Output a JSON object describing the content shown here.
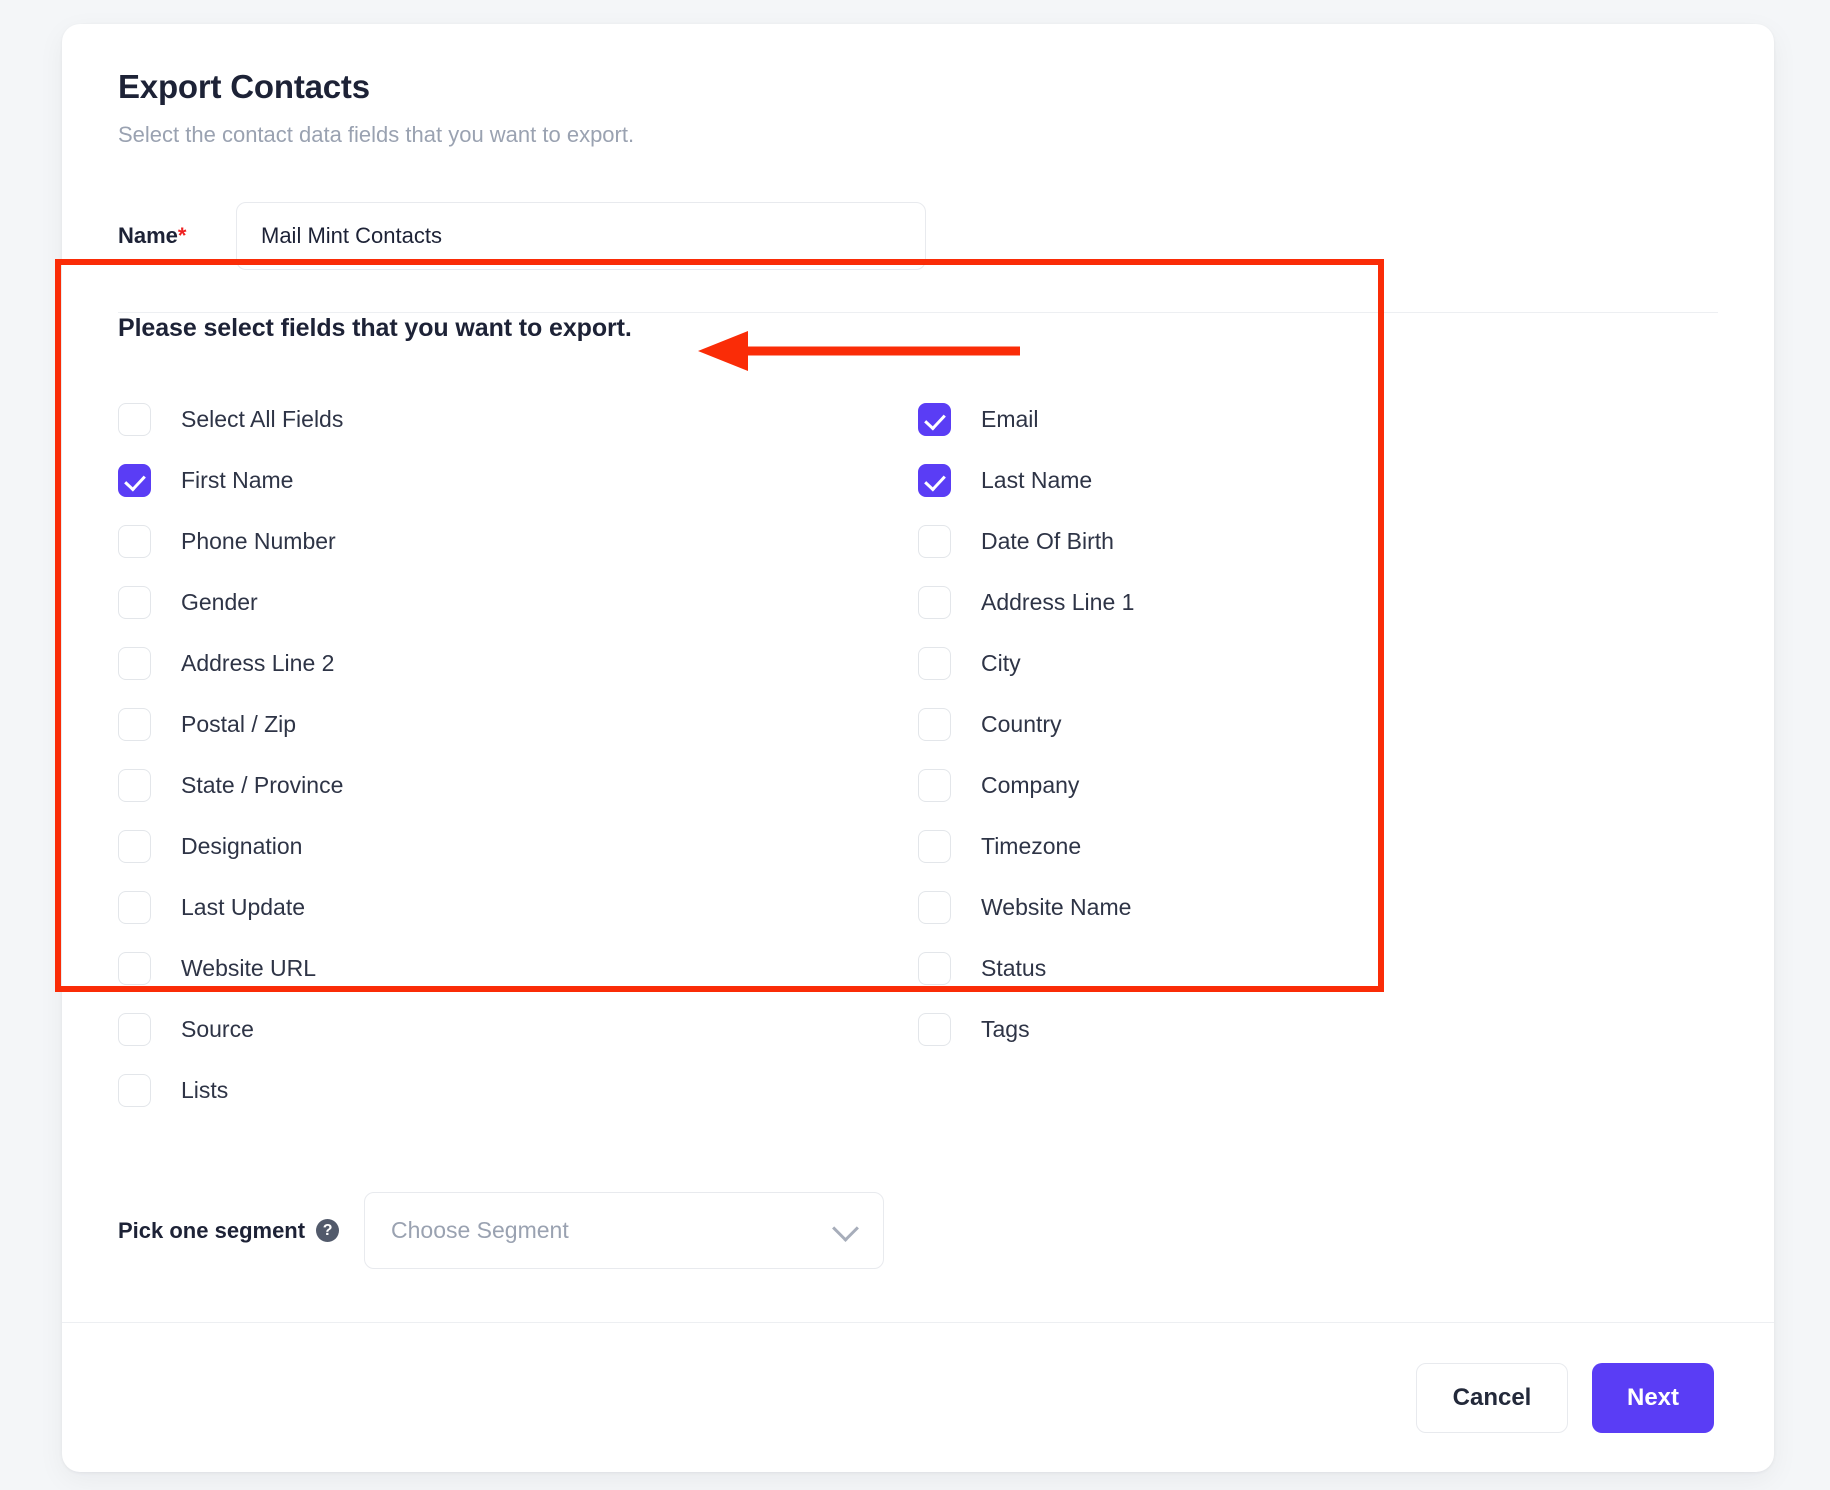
{
  "header": {
    "title": "Export Contacts",
    "subtitle": "Select the contact data fields that you want to export."
  },
  "name_field": {
    "label": "Name",
    "required_marker": "*",
    "value": "Mail Mint Contacts",
    "placeholder": "Mail Mint Contacts"
  },
  "fields_section": {
    "title": "Please select fields that you want to export.",
    "left_column": [
      {
        "label": "Select All Fields",
        "checked": false
      },
      {
        "label": "First Name",
        "checked": true
      },
      {
        "label": "Phone Number",
        "checked": false
      },
      {
        "label": "Gender",
        "checked": false
      },
      {
        "label": "Address Line 2",
        "checked": false
      },
      {
        "label": "Postal / Zip",
        "checked": false
      },
      {
        "label": "State / Province",
        "checked": false
      },
      {
        "label": "Designation",
        "checked": false
      },
      {
        "label": "Last Update",
        "checked": false
      },
      {
        "label": "Website URL",
        "checked": false
      },
      {
        "label": "Source",
        "checked": false
      },
      {
        "label": "Lists",
        "checked": false
      }
    ],
    "right_column": [
      {
        "label": "Email",
        "checked": true
      },
      {
        "label": "Last Name",
        "checked": true
      },
      {
        "label": "Date Of Birth",
        "checked": false
      },
      {
        "label": "Address Line 1",
        "checked": false
      },
      {
        "label": "City",
        "checked": false
      },
      {
        "label": "Country",
        "checked": false
      },
      {
        "label": "Company",
        "checked": false
      },
      {
        "label": "Timezone",
        "checked": false
      },
      {
        "label": "Website Name",
        "checked": false
      },
      {
        "label": "Status",
        "checked": false
      },
      {
        "label": "Tags",
        "checked": false
      }
    ]
  },
  "segment": {
    "label": "Pick one segment",
    "help_icon": "question-mark-icon",
    "placeholder": "Choose Segment",
    "value": "",
    "chevron_icon": "chevron-down-icon"
  },
  "footer": {
    "cancel_label": "Cancel",
    "next_label": "Next"
  },
  "annotations": {
    "highlight_box_color": "#fa2c07",
    "arrow_color": "#fa2c07",
    "arrow_direction": "left",
    "arrow_target": "Please select fields that you want to export."
  },
  "colors": {
    "accent": "#5a3df5",
    "page_background": "#f4f6f8",
    "card_background": "#ffffff",
    "text_primary": "#1d2236",
    "text_muted": "#9aa2b1",
    "required_marker": "#ef2222"
  }
}
